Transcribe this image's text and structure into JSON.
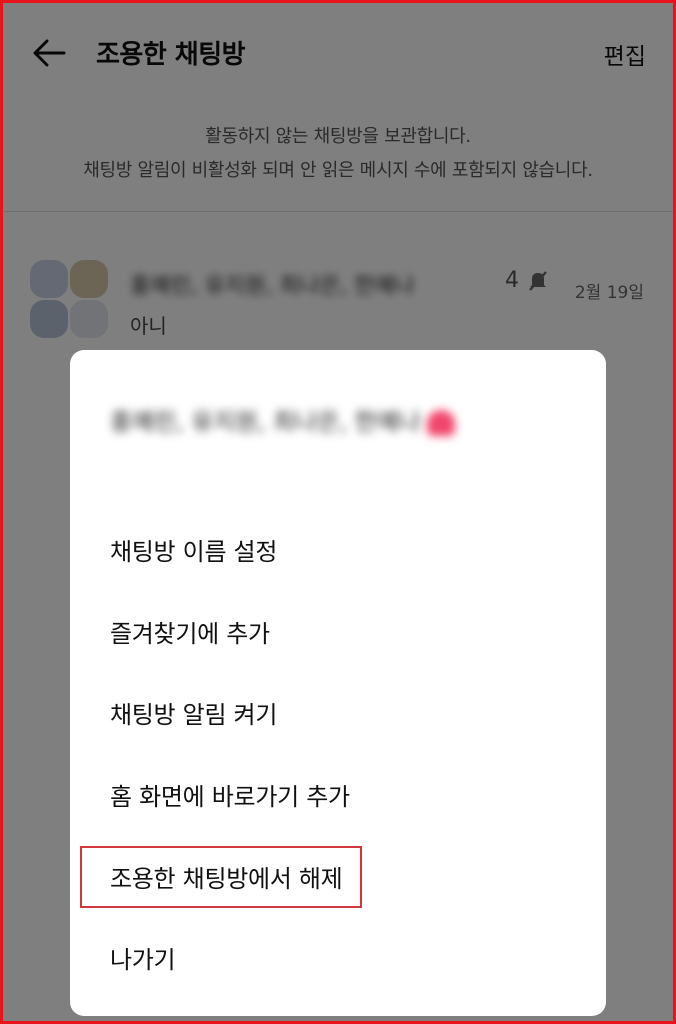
{
  "header": {
    "title": "조용한 채팅방",
    "edit_label": "편집"
  },
  "info": {
    "line1": "활동하지 않는 채팅방을 보관합니다.",
    "line2": "채팅방 알림이 비활성화 되며 안 읽은 메시지 수에 포함되지 않습니다."
  },
  "chat": {
    "name": "홍예린, 유지원, 최나은, 한예나",
    "member_count": "4",
    "date": "2월 19일",
    "preview": "아니"
  },
  "dialog": {
    "title": "홍예린, 유지원, 최나은, 한예나",
    "menu": [
      "채팅방 이름 설정",
      "즐겨찾기에 추가",
      "채팅방 알림 켜기",
      "홈 화면에 바로가기 추가",
      "조용한 채팅방에서 해제",
      "나가기"
    ]
  },
  "colors": {
    "overlay": "#808080",
    "highlight": "#d3363c",
    "frame": "#e8141c",
    "heart": "#f0466c"
  },
  "icons": {
    "back": "arrow-left",
    "mute": "bell-slash"
  }
}
